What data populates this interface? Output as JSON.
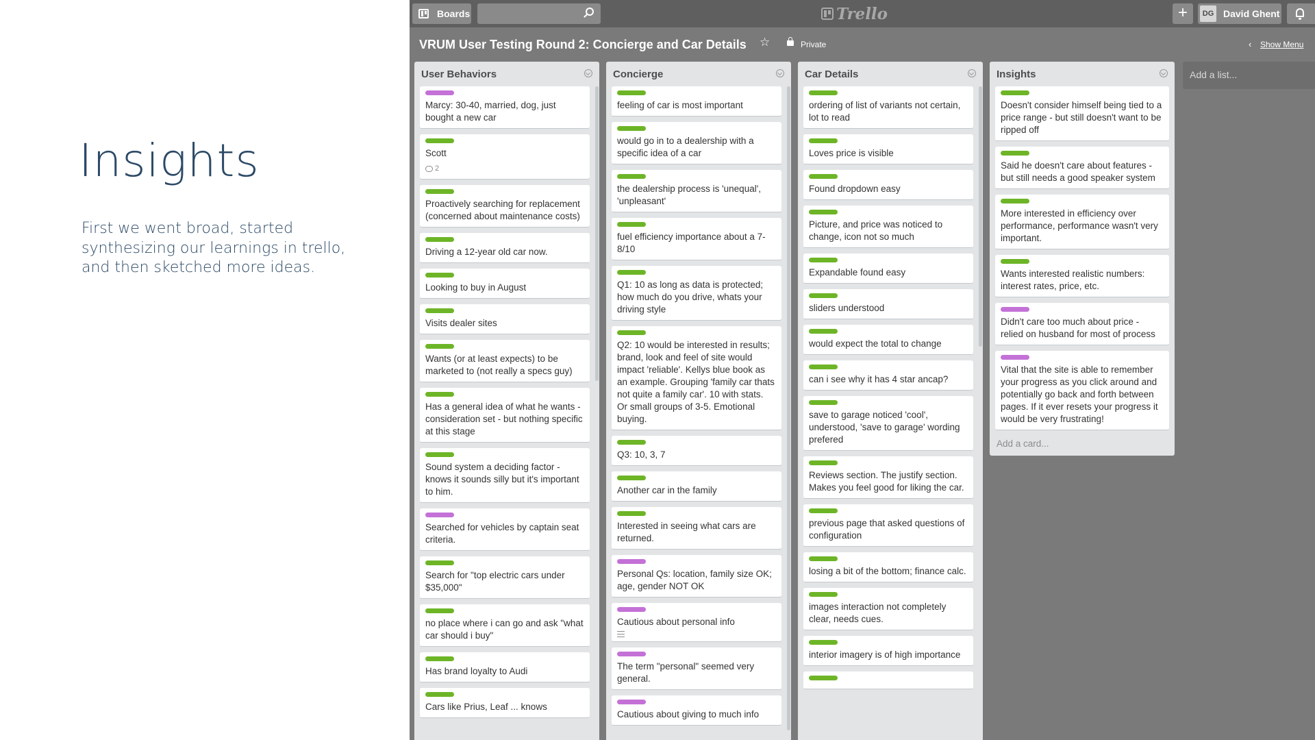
{
  "slide": {
    "title": "Insights",
    "body": "First we went broad, started synthesizing our learnings in trello, and then sketched more ideas."
  },
  "topbar": {
    "boards_label": "Boards",
    "search_placeholder": "",
    "logo_text": "Trello",
    "add_label": "+",
    "user_initials": "DG",
    "user_name": "David Ghent"
  },
  "board": {
    "title": "VRUM User Testing Round 2: Concierge and Car Details",
    "visibility": "Private",
    "show_menu": "Show Menu",
    "add_list": "Add a list..."
  },
  "colors": {
    "green_label": "#6db527",
    "purple_label": "#c471d7",
    "board_bg": "#7a7a7a"
  },
  "lists": [
    {
      "title": "User Behaviors",
      "cards": [
        {
          "label": "purple",
          "text": "Marcy: 30-40, married, dog, just bought a new car"
        },
        {
          "label": "green",
          "text": "Scott",
          "comments": "2"
        },
        {
          "label": "green",
          "text": "Proactively searching for replacement (concerned about maintenance costs)"
        },
        {
          "label": "green",
          "text": "Driving a 12-year old car now."
        },
        {
          "label": "green",
          "text": "Looking to buy in August"
        },
        {
          "label": "green",
          "text": "Visits dealer sites"
        },
        {
          "label": "green",
          "text": "Wants (or at least expects) to be marketed to (not really a specs guy)"
        },
        {
          "label": "green",
          "text": "Has a general idea of what he wants - consideration set - but nothing specific at this stage"
        },
        {
          "label": "green",
          "text": "Sound system a deciding factor - knows it sounds silly but it's important to him."
        },
        {
          "label": "purple",
          "text": "Searched for vehicles by captain seat criteria."
        },
        {
          "label": "green",
          "text": "Search for \"top electric cars under $35,000\""
        },
        {
          "label": "green",
          "text": "no place where i can go and ask \"what car should i buy\""
        },
        {
          "label": "green",
          "text": "Has brand loyalty to Audi"
        },
        {
          "label": "green",
          "text": "Cars like Prius, Leaf ... knows"
        }
      ]
    },
    {
      "title": "Concierge",
      "cards": [
        {
          "label": "green",
          "text": "feeling of car is most important"
        },
        {
          "label": "green",
          "text": "would go in to a dealership with a specific idea of a car"
        },
        {
          "label": "green",
          "text": "the dealership process is 'unequal', 'unpleasant'"
        },
        {
          "label": "green",
          "text": "fuel efficiency importance about a 7-8/10"
        },
        {
          "label": "green",
          "text": "Q1: 10 as long as data is protected; how much do you drive, whats your driving style"
        },
        {
          "label": "green",
          "text": "Q2: 10 would be interested in results; brand, look and feel of site would impact 'reliable'. Kellys blue book as an example. Grouping 'family car thats not quite a family car'. 10 with stats. Or small groups of 3-5. Emotional buying."
        },
        {
          "label": "green",
          "text": "Q3: 10, 3, 7"
        },
        {
          "label": "green",
          "text": "Another car in the family"
        },
        {
          "label": "green",
          "text": "Interested in seeing what cars are returned."
        },
        {
          "label": "purple",
          "text": "Personal Qs: location, family size OK; age, gender NOT OK"
        },
        {
          "label": "purple",
          "text": "Cautious about personal info",
          "description": true
        },
        {
          "label": "purple",
          "text": "The term \"personal\" seemed very general."
        },
        {
          "label": "purple",
          "text": "Cautious about giving to much info"
        }
      ]
    },
    {
      "title": "Car Details",
      "cards": [
        {
          "label": "green",
          "text": "ordering of list of variants not certain, lot to read"
        },
        {
          "label": "green",
          "text": "Loves price is visible"
        },
        {
          "label": "green",
          "text": "Found dropdown easy"
        },
        {
          "label": "green",
          "text": "Picture, and price was noticed to change, icon not so much"
        },
        {
          "label": "green",
          "text": "Expandable found easy"
        },
        {
          "label": "green",
          "text": "sliders understood"
        },
        {
          "label": "green",
          "text": "would expect the total to change"
        },
        {
          "label": "green",
          "text": "can i see why it has 4 star ancap?"
        },
        {
          "label": "green",
          "text": "save to garage noticed 'cool', understood, 'save to garage' wording prefered"
        },
        {
          "label": "green",
          "text": "Reviews section. The justify section. Makes you feel good for liking the car."
        },
        {
          "label": "green",
          "text": "previous page that asked questions of configuration"
        },
        {
          "label": "green",
          "text": "losing a bit of the bottom; finance calc."
        },
        {
          "label": "green",
          "text": "images interaction not completely clear, needs cues."
        },
        {
          "label": "green",
          "text": "interior imagery is of high importance"
        },
        {
          "label": "green",
          "text": ""
        }
      ]
    },
    {
      "title": "Insights",
      "cards": [
        {
          "label": "green",
          "text": "Doesn't consider himself being tied to a price range - but still doesn't want to be ripped off"
        },
        {
          "label": "green",
          "text": "Said he doesn't care about features - but still needs a good speaker system"
        },
        {
          "label": "green",
          "text": "More interested in efficiency over performance, performance wasn't very important."
        },
        {
          "label": "green",
          "text": "Wants interested realistic numbers: interest rates, price, etc."
        },
        {
          "label": "purple",
          "text": "Didn't care too much about price - relied on husband for most of process"
        },
        {
          "label": "purple",
          "text": "Vital that the site is able to remember your progress as you click around and potentially go back and forth between pages. If it ever resets your progress it would be very frustrating!"
        }
      ],
      "add_card": "Add a card..."
    }
  ]
}
